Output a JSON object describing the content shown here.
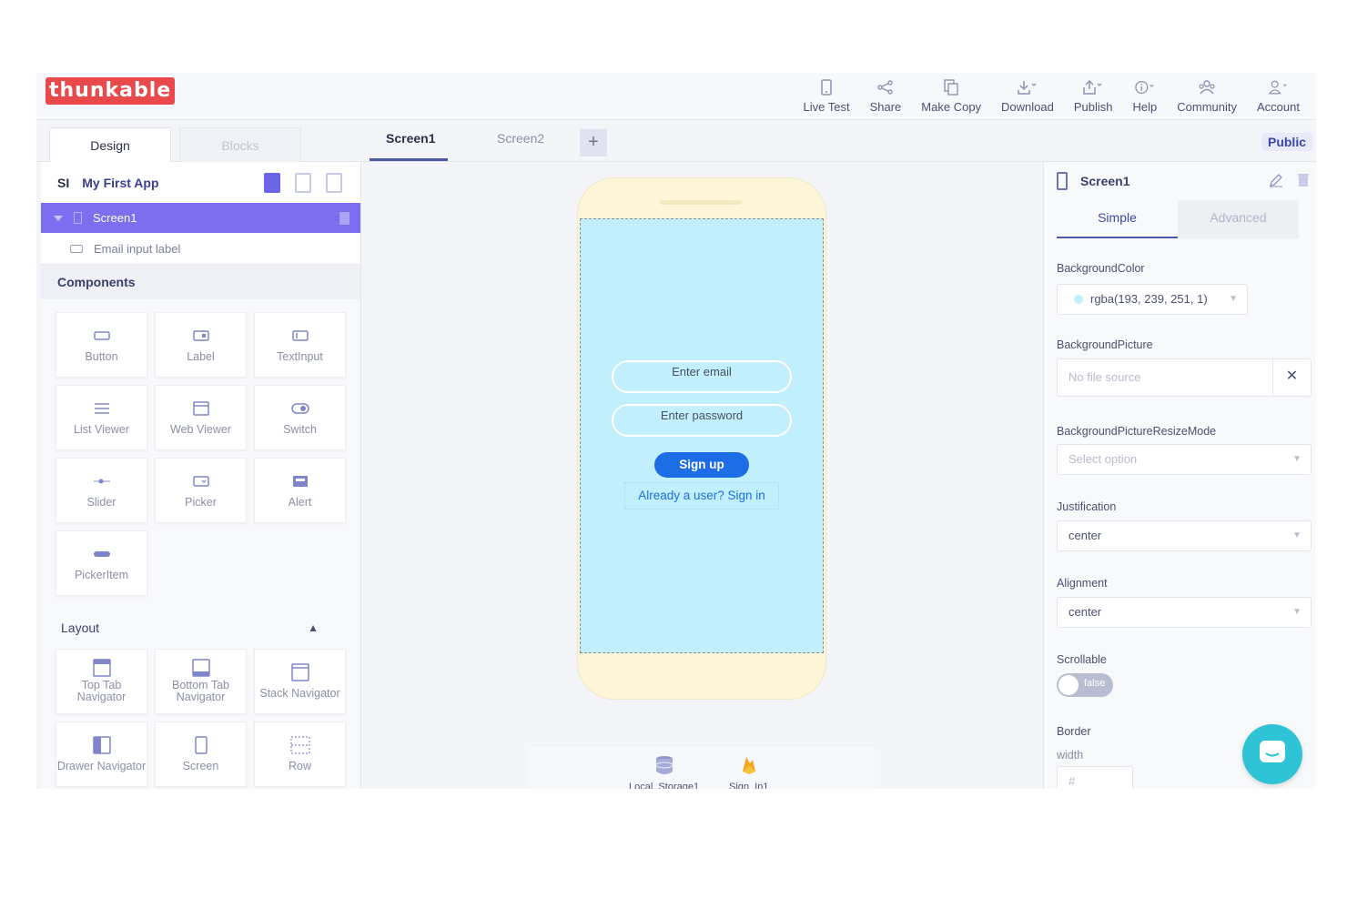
{
  "brand": {
    "logo_text": "thunkable"
  },
  "header": {
    "nav": [
      {
        "label": "Live Test",
        "icon": "phone-test-icon"
      },
      {
        "label": "Share",
        "icon": "share-icon"
      },
      {
        "label": "Make Copy",
        "icon": "copy-icon"
      },
      {
        "label": "Download",
        "icon": "download-icon"
      },
      {
        "label": "Publish",
        "icon": "publish-icon"
      },
      {
        "label": "Help",
        "icon": "info-icon"
      },
      {
        "label": "Community",
        "icon": "community-icon"
      },
      {
        "label": "Account",
        "icon": "account-icon"
      }
    ]
  },
  "tabs": {
    "design": "Design",
    "blocks": "Blocks",
    "screens": [
      "Screen1",
      "Screen2"
    ],
    "add": "+",
    "public": "Public"
  },
  "left": {
    "app_initials": "SI",
    "app_name": "My First App",
    "tree_screen": "Screen1",
    "tree_child": "Email input label",
    "components_title": "Components",
    "components": [
      {
        "label": "Button",
        "icon": "button-icon"
      },
      {
        "label": "Label",
        "icon": "label-icon"
      },
      {
        "label": "TextInput",
        "icon": "textinput-icon"
      },
      {
        "label": "List Viewer",
        "icon": "list-icon"
      },
      {
        "label": "Web Viewer",
        "icon": "web-viewer-icon"
      },
      {
        "label": "Switch",
        "icon": "switch-icon"
      },
      {
        "label": "Slider",
        "icon": "slider-icon"
      },
      {
        "label": "Picker",
        "icon": "picker-icon"
      },
      {
        "label": "Alert",
        "icon": "alert-icon"
      },
      {
        "label": "PickerItem",
        "icon": "picker-item-icon"
      }
    ],
    "layout_title": "Layout",
    "layout": [
      {
        "label": "Top Tab Navigator",
        "icon": "top-tab-icon"
      },
      {
        "label": "Bottom Tab Navigator",
        "icon": "bottom-tab-icon"
      },
      {
        "label": "Stack Navigator",
        "icon": "stack-icon"
      },
      {
        "label": "Drawer Navigator",
        "icon": "drawer-icon"
      },
      {
        "label": "Screen",
        "icon": "screen-icon"
      },
      {
        "label": "Row",
        "icon": "row-icon"
      }
    ]
  },
  "phone": {
    "email_placeholder": "Enter email",
    "password_placeholder": "Enter password",
    "signup": "Sign up",
    "signin": "Already a user? Sign in",
    "screen_color": "#c1effb",
    "invisible": [
      {
        "label": "Local_Storage1",
        "icon": "database-icon"
      },
      {
        "label": "Sign_In1",
        "icon": "firebase-icon"
      }
    ]
  },
  "right": {
    "screen_name": "Screen1",
    "tab_simple": "Simple",
    "tab_advanced": "Advanced",
    "bg_color_label": "BackgroundColor",
    "bg_color_value": "rgba(193, 239, 251, 1)",
    "bg_picture_label": "BackgroundPicture",
    "bg_picture_value": "No file source",
    "resize_label": "BackgroundPictureResizeMode",
    "resize_value": "Select option",
    "justification_label": "Justification",
    "justification_value": "center",
    "alignment_label": "Alignment",
    "alignment_value": "center",
    "scrollable_label": "Scrollable",
    "scrollable_value": "false",
    "border_label": "Border",
    "width_label": "width",
    "width_placeholder": "#"
  },
  "colors": {
    "accent": "#7b6ff0",
    "brand": "#e8494a",
    "primary_button": "#1d6ee6",
    "chat": "#2ec4d6"
  }
}
